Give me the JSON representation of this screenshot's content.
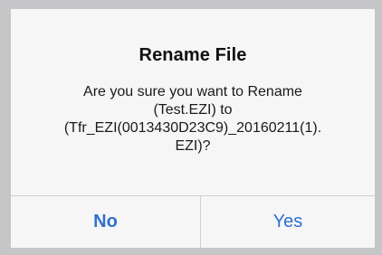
{
  "dialog": {
    "title": "Rename File",
    "message_lines": [
      "Are you sure you want to Rename",
      "(Test.EZI) to",
      "(Tfr_EZI(0013430D23C9)_20160211(1).",
      "EZI)?"
    ],
    "buttons": {
      "no_label": "No",
      "yes_label": "Yes"
    }
  },
  "colors": {
    "accent": "#2f6fcf",
    "dialog_background": "#f6f6f7",
    "backdrop": "#c6c6c8",
    "divider": "#cfcfd3"
  }
}
